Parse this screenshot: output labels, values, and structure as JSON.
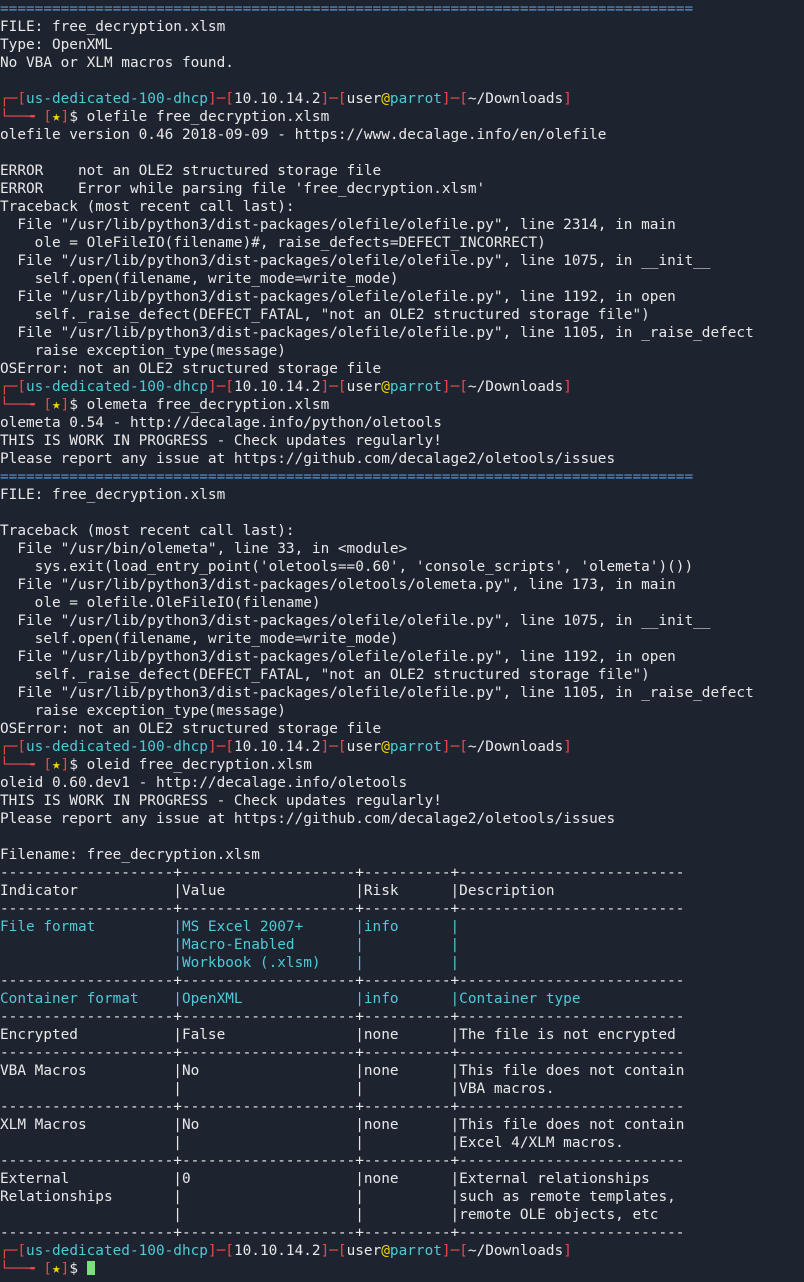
{
  "prompt": {
    "host": "us-dedicated-100-dhcp",
    "ip": "10.10.14.2",
    "user": "user",
    "at": "@",
    "machine": "parrot",
    "path": "~/Downloads",
    "dollar": "$",
    "star": "★"
  },
  "lines": [
    {
      "kind": "text",
      "cls": "blue",
      "text": "================================================================================"
    },
    {
      "kind": "text",
      "cls": "white",
      "text": "FILE: free_decryption.xlsm"
    },
    {
      "kind": "text",
      "cls": "white",
      "text": "Type: OpenXML"
    },
    {
      "kind": "text",
      "cls": "white",
      "text": "No VBA or XLM macros found."
    },
    {
      "kind": "text",
      "cls": "white",
      "text": ""
    },
    {
      "kind": "prompt1"
    },
    {
      "kind": "prompt2",
      "cmd": "olefile free_decryption.xlsm"
    },
    {
      "kind": "text",
      "cls": "white",
      "text": "olefile version 0.46 2018-09-09 - https://www.decalage.info/en/olefile"
    },
    {
      "kind": "text",
      "cls": "white",
      "text": ""
    },
    {
      "kind": "text",
      "cls": "white",
      "text": "ERROR    not an OLE2 structured storage file"
    },
    {
      "kind": "text",
      "cls": "white",
      "text": "ERROR    Error while parsing file 'free_decryption.xlsm'"
    },
    {
      "kind": "text",
      "cls": "white",
      "text": "Traceback (most recent call last):"
    },
    {
      "kind": "text",
      "cls": "white",
      "text": "  File \"/usr/lib/python3/dist-packages/olefile/olefile.py\", line 2314, in main"
    },
    {
      "kind": "text",
      "cls": "white",
      "text": "    ole = OleFileIO(filename)#, raise_defects=DEFECT_INCORRECT)"
    },
    {
      "kind": "text",
      "cls": "white",
      "text": "  File \"/usr/lib/python3/dist-packages/olefile/olefile.py\", line 1075, in __init__"
    },
    {
      "kind": "text",
      "cls": "white",
      "text": "    self.open(filename, write_mode=write_mode)"
    },
    {
      "kind": "text",
      "cls": "white",
      "text": "  File \"/usr/lib/python3/dist-packages/olefile/olefile.py\", line 1192, in open"
    },
    {
      "kind": "text",
      "cls": "white",
      "text": "    self._raise_defect(DEFECT_FATAL, \"not an OLE2 structured storage file\")"
    },
    {
      "kind": "text",
      "cls": "white",
      "text": "  File \"/usr/lib/python3/dist-packages/olefile/olefile.py\", line 1105, in _raise_defect"
    },
    {
      "kind": "text",
      "cls": "white",
      "text": "    raise exception_type(message)"
    },
    {
      "kind": "text",
      "cls": "white",
      "text": "OSError: not an OLE2 structured storage file"
    },
    {
      "kind": "prompt1"
    },
    {
      "kind": "prompt2",
      "cmd": "olemeta free_decryption.xlsm"
    },
    {
      "kind": "text",
      "cls": "white",
      "text": "olemeta 0.54 - http://decalage.info/python/oletools"
    },
    {
      "kind": "text",
      "cls": "white",
      "text": "THIS IS WORK IN PROGRESS - Check updates regularly!"
    },
    {
      "kind": "text",
      "cls": "white",
      "text": "Please report any issue at https://github.com/decalage2/oletools/issues"
    },
    {
      "kind": "text",
      "cls": "blue",
      "text": "================================================================================"
    },
    {
      "kind": "text",
      "cls": "white",
      "text": "FILE: free_decryption.xlsm"
    },
    {
      "kind": "text",
      "cls": "white",
      "text": ""
    },
    {
      "kind": "text",
      "cls": "white",
      "text": "Traceback (most recent call last):"
    },
    {
      "kind": "text",
      "cls": "white",
      "text": "  File \"/usr/bin/olemeta\", line 33, in <module>"
    },
    {
      "kind": "text",
      "cls": "white",
      "text": "    sys.exit(load_entry_point('oletools==0.60', 'console_scripts', 'olemeta')())"
    },
    {
      "kind": "text",
      "cls": "white",
      "text": "  File \"/usr/lib/python3/dist-packages/oletools/olemeta.py\", line 173, in main"
    },
    {
      "kind": "text",
      "cls": "white",
      "text": "    ole = olefile.OleFileIO(filename)"
    },
    {
      "kind": "text",
      "cls": "white",
      "text": "  File \"/usr/lib/python3/dist-packages/olefile/olefile.py\", line 1075, in __init__"
    },
    {
      "kind": "text",
      "cls": "white",
      "text": "    self.open(filename, write_mode=write_mode)"
    },
    {
      "kind": "text",
      "cls": "white",
      "text": "  File \"/usr/lib/python3/dist-packages/olefile/olefile.py\", line 1192, in open"
    },
    {
      "kind": "text",
      "cls": "white",
      "text": "    self._raise_defect(DEFECT_FATAL, \"not an OLE2 structured storage file\")"
    },
    {
      "kind": "text",
      "cls": "white",
      "text": "  File \"/usr/lib/python3/dist-packages/olefile/olefile.py\", line 1105, in _raise_defect"
    },
    {
      "kind": "text",
      "cls": "white",
      "text": "    raise exception_type(message)"
    },
    {
      "kind": "text",
      "cls": "white",
      "text": "OSError: not an OLE2 structured storage file"
    },
    {
      "kind": "prompt1"
    },
    {
      "kind": "prompt2",
      "cmd": "oleid free_decryption.xlsm"
    },
    {
      "kind": "text",
      "cls": "white",
      "text": "oleid 0.60.dev1 - http://decalage.info/oletools"
    },
    {
      "kind": "text",
      "cls": "white",
      "text": "THIS IS WORK IN PROGRESS - Check updates regularly!"
    },
    {
      "kind": "text",
      "cls": "white",
      "text": "Please report any issue at https://github.com/decalage2/oletools/issues"
    },
    {
      "kind": "text",
      "cls": "white",
      "text": ""
    },
    {
      "kind": "text",
      "cls": "white",
      "text": "Filename: free_decryption.xlsm"
    },
    {
      "kind": "text",
      "cls": "white",
      "text": "--------------------+--------------------+----------+--------------------------"
    },
    {
      "kind": "text",
      "cls": "white",
      "text": "Indicator           |Value               |Risk      |Description"
    },
    {
      "kind": "text",
      "cls": "white",
      "text": "--------------------+--------------------+----------+--------------------------"
    },
    {
      "kind": "text",
      "cls": "cyan",
      "text": "File format         |MS Excel 2007+      |info      |"
    },
    {
      "kind": "text",
      "cls": "cyan",
      "text": "                    |Macro-Enabled       |          |"
    },
    {
      "kind": "text",
      "cls": "cyan",
      "text": "                    |Workbook (.xlsm)    |          |"
    },
    {
      "kind": "text",
      "cls": "white",
      "text": "--------------------+--------------------+----------+--------------------------"
    },
    {
      "kind": "text",
      "cls": "cyan",
      "text": "Container format    |OpenXML             |info      |Container type"
    },
    {
      "kind": "text",
      "cls": "white",
      "text": "--------------------+--------------------+----------+--------------------------"
    },
    {
      "kind": "text",
      "cls": "white",
      "text": "Encrypted           |False               |none      |The file is not encrypted"
    },
    {
      "kind": "text",
      "cls": "white",
      "text": "--------------------+--------------------+----------+--------------------------"
    },
    {
      "kind": "text",
      "cls": "white",
      "text": "VBA Macros          |No                  |none      |This file does not contain"
    },
    {
      "kind": "text",
      "cls": "white",
      "text": "                    |                    |          |VBA macros."
    },
    {
      "kind": "text",
      "cls": "white",
      "text": "--------------------+--------------------+----------+--------------------------"
    },
    {
      "kind": "text",
      "cls": "white",
      "text": "XLM Macros          |No                  |none      |This file does not contain"
    },
    {
      "kind": "text",
      "cls": "white",
      "text": "                    |                    |          |Excel 4/XLM macros."
    },
    {
      "kind": "text",
      "cls": "white",
      "text": "--------------------+--------------------+----------+--------------------------"
    },
    {
      "kind": "text",
      "cls": "white",
      "text": "External            |0                   |none      |External relationships"
    },
    {
      "kind": "text",
      "cls": "white",
      "text": "Relationships       |                    |          |such as remote templates,"
    },
    {
      "kind": "text",
      "cls": "white",
      "text": "                    |                    |          |remote OLE objects, etc"
    },
    {
      "kind": "text",
      "cls": "white",
      "text": "--------------------+--------------------+----------+--------------------------"
    },
    {
      "kind": "prompt1"
    },
    {
      "kind": "prompt2",
      "cmd": "",
      "cursor": true
    }
  ]
}
